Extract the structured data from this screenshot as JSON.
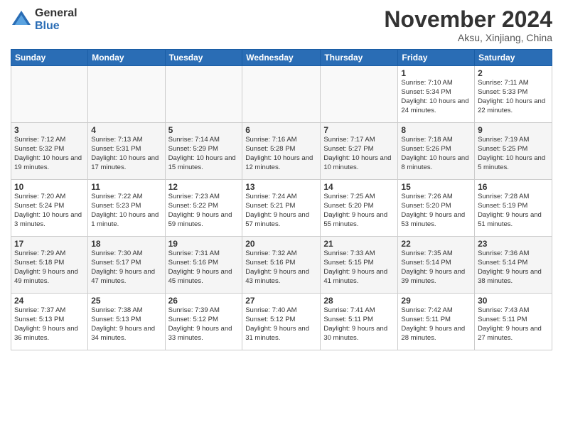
{
  "header": {
    "logo_general": "General",
    "logo_blue": "Blue",
    "month_title": "November 2024",
    "location": "Aksu, Xinjiang, China"
  },
  "days_of_week": [
    "Sunday",
    "Monday",
    "Tuesday",
    "Wednesday",
    "Thursday",
    "Friday",
    "Saturday"
  ],
  "weeks": [
    [
      {
        "day": "",
        "info": ""
      },
      {
        "day": "",
        "info": ""
      },
      {
        "day": "",
        "info": ""
      },
      {
        "day": "",
        "info": ""
      },
      {
        "day": "",
        "info": ""
      },
      {
        "day": "1",
        "info": "Sunrise: 7:10 AM\nSunset: 5:34 PM\nDaylight: 10 hours\nand 24 minutes."
      },
      {
        "day": "2",
        "info": "Sunrise: 7:11 AM\nSunset: 5:33 PM\nDaylight: 10 hours\nand 22 minutes."
      }
    ],
    [
      {
        "day": "3",
        "info": "Sunrise: 7:12 AM\nSunset: 5:32 PM\nDaylight: 10 hours\nand 19 minutes."
      },
      {
        "day": "4",
        "info": "Sunrise: 7:13 AM\nSunset: 5:31 PM\nDaylight: 10 hours\nand 17 minutes."
      },
      {
        "day": "5",
        "info": "Sunrise: 7:14 AM\nSunset: 5:29 PM\nDaylight: 10 hours\nand 15 minutes."
      },
      {
        "day": "6",
        "info": "Sunrise: 7:16 AM\nSunset: 5:28 PM\nDaylight: 10 hours\nand 12 minutes."
      },
      {
        "day": "7",
        "info": "Sunrise: 7:17 AM\nSunset: 5:27 PM\nDaylight: 10 hours\nand 10 minutes."
      },
      {
        "day": "8",
        "info": "Sunrise: 7:18 AM\nSunset: 5:26 PM\nDaylight: 10 hours\nand 8 minutes."
      },
      {
        "day": "9",
        "info": "Sunrise: 7:19 AM\nSunset: 5:25 PM\nDaylight: 10 hours\nand 5 minutes."
      }
    ],
    [
      {
        "day": "10",
        "info": "Sunrise: 7:20 AM\nSunset: 5:24 PM\nDaylight: 10 hours\nand 3 minutes."
      },
      {
        "day": "11",
        "info": "Sunrise: 7:22 AM\nSunset: 5:23 PM\nDaylight: 10 hours\nand 1 minute."
      },
      {
        "day": "12",
        "info": "Sunrise: 7:23 AM\nSunset: 5:22 PM\nDaylight: 9 hours\nand 59 minutes."
      },
      {
        "day": "13",
        "info": "Sunrise: 7:24 AM\nSunset: 5:21 PM\nDaylight: 9 hours\nand 57 minutes."
      },
      {
        "day": "14",
        "info": "Sunrise: 7:25 AM\nSunset: 5:20 PM\nDaylight: 9 hours\nand 55 minutes."
      },
      {
        "day": "15",
        "info": "Sunrise: 7:26 AM\nSunset: 5:20 PM\nDaylight: 9 hours\nand 53 minutes."
      },
      {
        "day": "16",
        "info": "Sunrise: 7:28 AM\nSunset: 5:19 PM\nDaylight: 9 hours\nand 51 minutes."
      }
    ],
    [
      {
        "day": "17",
        "info": "Sunrise: 7:29 AM\nSunset: 5:18 PM\nDaylight: 9 hours\nand 49 minutes."
      },
      {
        "day": "18",
        "info": "Sunrise: 7:30 AM\nSunset: 5:17 PM\nDaylight: 9 hours\nand 47 minutes."
      },
      {
        "day": "19",
        "info": "Sunrise: 7:31 AM\nSunset: 5:16 PM\nDaylight: 9 hours\nand 45 minutes."
      },
      {
        "day": "20",
        "info": "Sunrise: 7:32 AM\nSunset: 5:16 PM\nDaylight: 9 hours\nand 43 minutes."
      },
      {
        "day": "21",
        "info": "Sunrise: 7:33 AM\nSunset: 5:15 PM\nDaylight: 9 hours\nand 41 minutes."
      },
      {
        "day": "22",
        "info": "Sunrise: 7:35 AM\nSunset: 5:14 PM\nDaylight: 9 hours\nand 39 minutes."
      },
      {
        "day": "23",
        "info": "Sunrise: 7:36 AM\nSunset: 5:14 PM\nDaylight: 9 hours\nand 38 minutes."
      }
    ],
    [
      {
        "day": "24",
        "info": "Sunrise: 7:37 AM\nSunset: 5:13 PM\nDaylight: 9 hours\nand 36 minutes."
      },
      {
        "day": "25",
        "info": "Sunrise: 7:38 AM\nSunset: 5:13 PM\nDaylight: 9 hours\nand 34 minutes."
      },
      {
        "day": "26",
        "info": "Sunrise: 7:39 AM\nSunset: 5:12 PM\nDaylight: 9 hours\nand 33 minutes."
      },
      {
        "day": "27",
        "info": "Sunrise: 7:40 AM\nSunset: 5:12 PM\nDaylight: 9 hours\nand 31 minutes."
      },
      {
        "day": "28",
        "info": "Sunrise: 7:41 AM\nSunset: 5:11 PM\nDaylight: 9 hours\nand 30 minutes."
      },
      {
        "day": "29",
        "info": "Sunrise: 7:42 AM\nSunset: 5:11 PM\nDaylight: 9 hours\nand 28 minutes."
      },
      {
        "day": "30",
        "info": "Sunrise: 7:43 AM\nSunset: 5:11 PM\nDaylight: 9 hours\nand 27 minutes."
      }
    ]
  ]
}
